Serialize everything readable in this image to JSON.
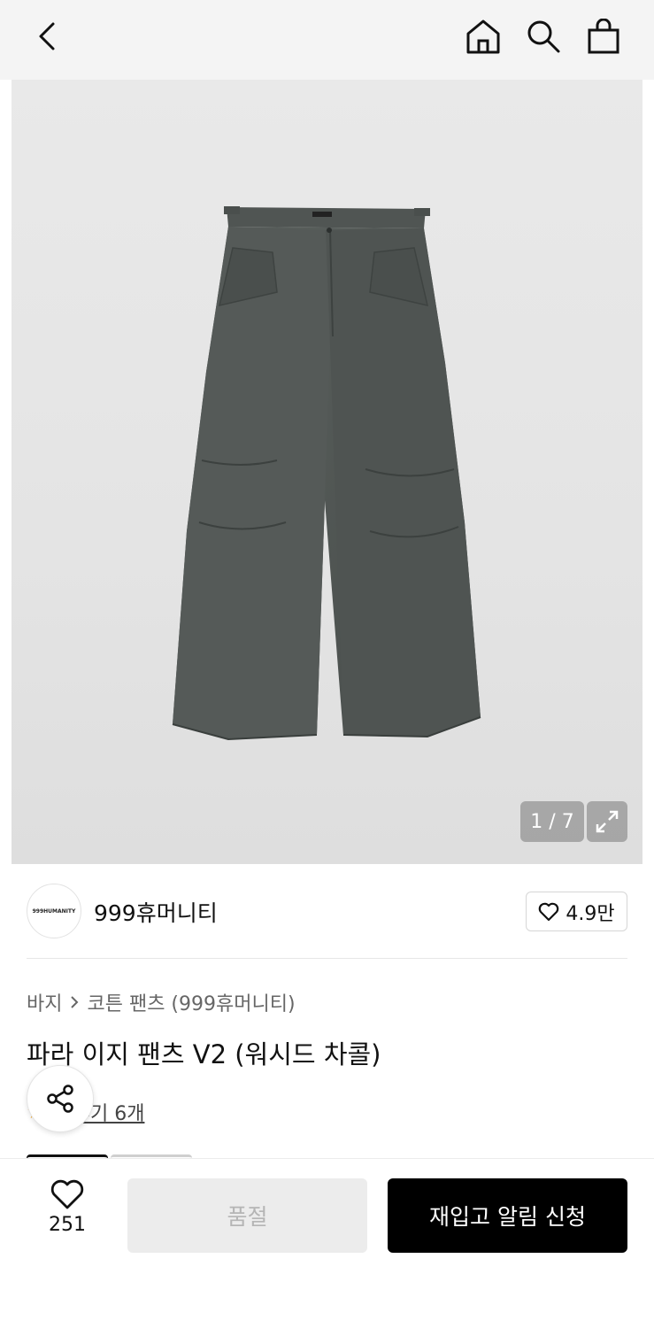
{
  "header": {
    "back_icon": "chevron-left-icon",
    "home_icon": "home-icon",
    "search_icon": "search-icon",
    "bag_icon": "shopping-bag-icon"
  },
  "gallery": {
    "counter": "1 / 7",
    "expand_icon": "expand-icon",
    "image_subject": "charcoal parachute pants"
  },
  "brand": {
    "logo_text": "999HUMANITY",
    "name": "999휴머니티",
    "like_count": "4.9만"
  },
  "breadcrumb": {
    "category": "바지",
    "separator_icon": "chevron-right-icon",
    "subcategory": "코튼 팬츠 (999휴머니티)"
  },
  "product": {
    "title": "파라 이지 팬츠 V2 (워시드 차콜)",
    "review_link": "후기 6개"
  },
  "bottom": {
    "wish_count": "251",
    "soldout_label": "품절",
    "restock_label": "재입고 알림 신청"
  },
  "colors": {
    "accent_star": "#f5a623",
    "primary_button": "#000000",
    "disabled_button": "#ececec"
  }
}
